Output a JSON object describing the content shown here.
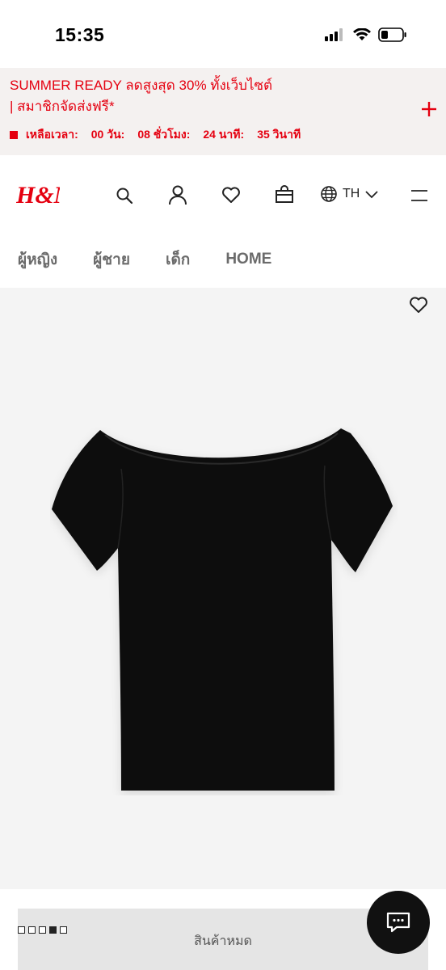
{
  "status_bar": {
    "time": "15:35"
  },
  "promo": {
    "line1": "SUMMER READY ลดสูงสุด 30% ทั้งเว็บไซต์",
    "line2": "| สมาชิกจัดส่งฟรี*",
    "countdown": {
      "label": "เหลือเวลา:",
      "days": "00 วัน:",
      "hours": "08 ชั่วโมง:",
      "minutes": "24 นาที:",
      "seconds": "35 วินาที"
    },
    "accent_color": "#e50010"
  },
  "header": {
    "logo": "H&M",
    "language": "TH"
  },
  "nav": {
    "items": [
      "ผู้หญิง",
      "ผู้ชาย",
      "เด็ก",
      "HOME"
    ]
  },
  "product": {
    "image_icon": "black-off-shoulder-top",
    "gallery_index": 4,
    "gallery_count": 5,
    "sold_out_label": "สินค้าหมด"
  },
  "icons": [
    "search-icon",
    "account-icon",
    "heart-icon",
    "bag-icon",
    "globe-icon",
    "chevron-down-icon",
    "menu-icon",
    "plus-icon",
    "chat-icon"
  ]
}
